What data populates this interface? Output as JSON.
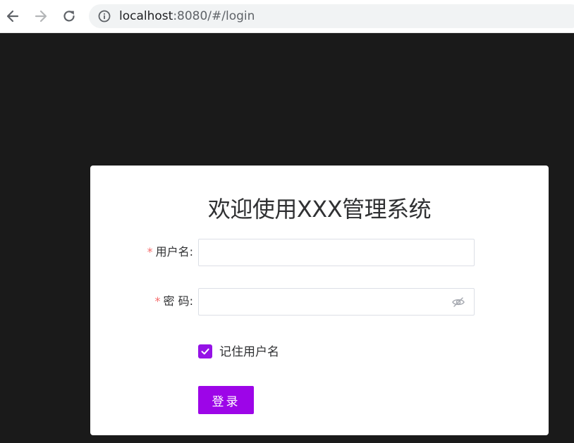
{
  "browser": {
    "url_host": "localhost",
    "url_rest": ":8080/#/login"
  },
  "login": {
    "title": "欢迎使用XXX管理系统",
    "username_label": "用户名:",
    "username_required": "*",
    "username_value": "",
    "password_label": "密 码:",
    "password_required": "*",
    "password_value": "",
    "remember_label": "记住用户名",
    "remember_checked": true,
    "button_label": "登录"
  },
  "colors": {
    "primary": "#9d05e8",
    "required": "#f56c6c",
    "background": "#1a1a1a",
    "card": "#ffffff"
  },
  "icons": {
    "back": "arrow-left-icon",
    "forward": "arrow-right-icon",
    "reload": "reload-icon",
    "info": "info-circle-icon",
    "password_toggle": "eye-off-icon",
    "checkbox_check": "checkmark-icon"
  }
}
